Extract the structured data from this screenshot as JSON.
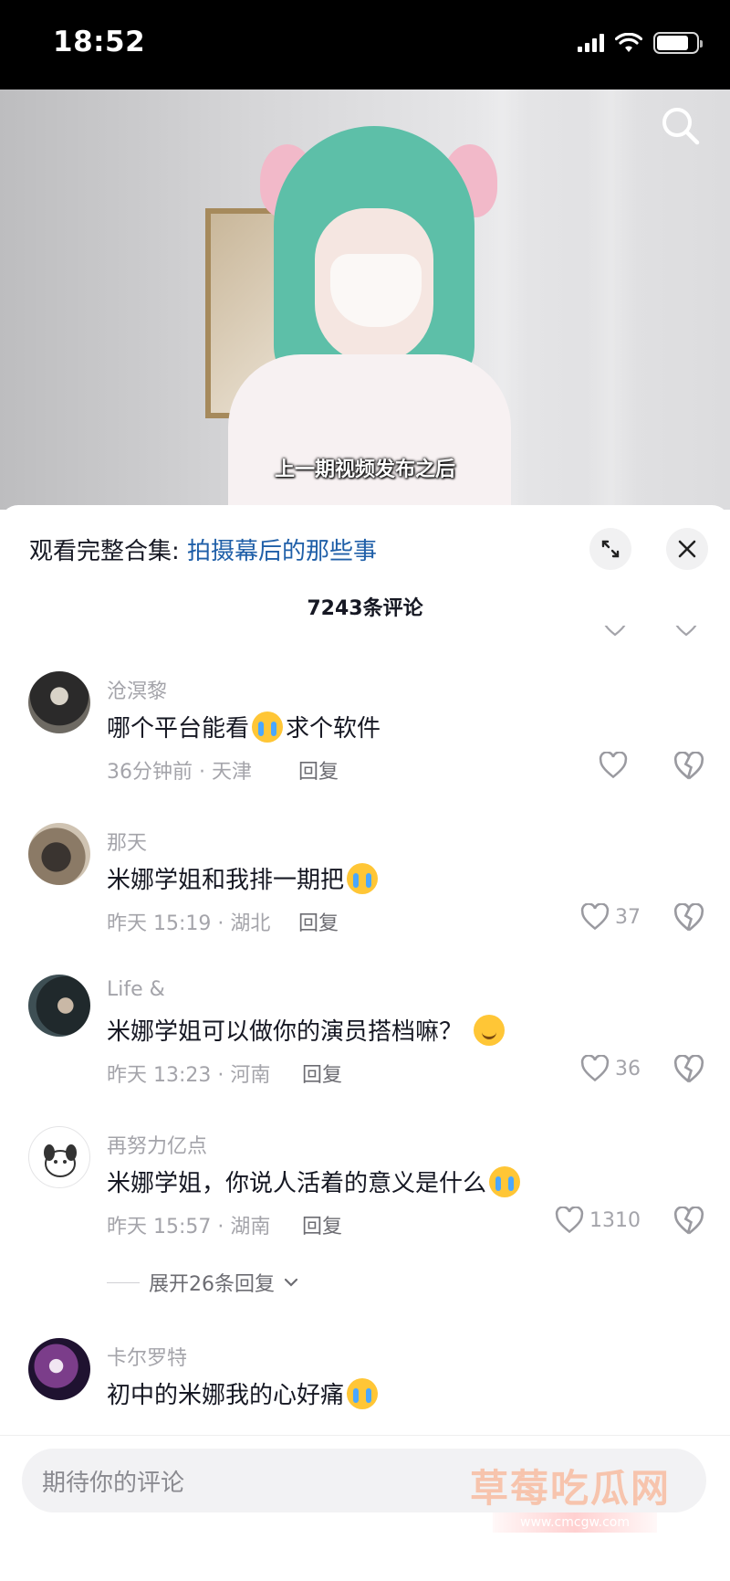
{
  "status_bar": {
    "time": "18:52"
  },
  "video": {
    "subtitle": "上一期视频发布之后"
  },
  "sheet": {
    "collection_prefix": "观看完整合集: ",
    "collection_title": "拍摄幕后的那些事",
    "comment_count": "7243条评论"
  },
  "comments": [
    {
      "username": "沧溟黎",
      "text_before": "哪个平台能看",
      "emoji": "cry",
      "text_after": "求个软件",
      "meta": "36分钟前 · 天津",
      "reply": "回复",
      "likes": ""
    },
    {
      "username": "那天",
      "text_before": "米娜学姐和我排一期把",
      "emoji": "cry",
      "text_after": "",
      "meta": "昨天 15:19 · 湖北",
      "reply": "回复",
      "likes": "37"
    },
    {
      "username": "Life &",
      "text_before": "米娜学姐可以做你的演员搭档嘛？",
      "emoji": "smile",
      "text_after": "",
      "meta": "昨天 13:23 · 河南",
      "reply": "回复",
      "likes": "36"
    },
    {
      "username": "再努力亿点",
      "text_before": "米娜学姐，你说人活着的意义是什么",
      "emoji": "cry",
      "text_after": "",
      "meta": "昨天 15:57 · 湖南",
      "reply": "回复",
      "likes": "1310",
      "expand": "展开26条回复"
    },
    {
      "username": "卡尔罗特",
      "text_before": "初中的米娜我的心好痛",
      "emoji": "cry",
      "text_after": ""
    }
  ],
  "input": {
    "placeholder": "期待你的评论"
  },
  "watermark": {
    "text": "草莓吃瓜网",
    "url": "www.cmcgw.com"
  },
  "colors": {
    "link": "#1f5fa8",
    "meta": "#a4a4aa",
    "text": "#161823"
  }
}
